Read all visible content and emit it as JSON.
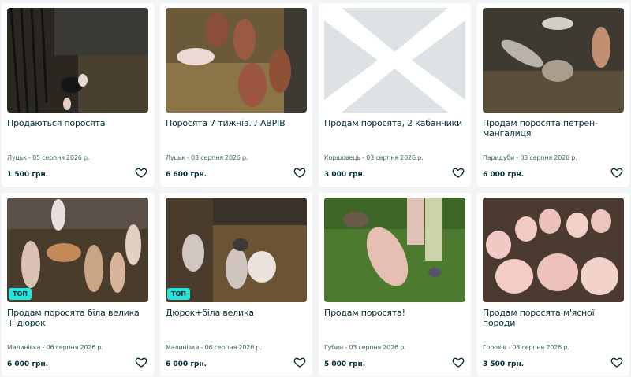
{
  "listings": [
    {
      "title": "Продаються поросята",
      "location_date": "Луцьк - 05 серпня 2026 р.",
      "price": "1 500 грн.",
      "badge": "",
      "photo": "pigs-in-dark-pen"
    },
    {
      "title": "Поросята 7 тижнів. ЛАВРІВ",
      "location_date": "Луцьк - 03 серпня 2026 р.",
      "price": "6 600 грн.",
      "badge": "",
      "photo": "brown-and-white-pigs-on-straw"
    },
    {
      "title": "Продам поросята, 2 кабанчики",
      "location_date": "Коршовець - 03 серпня 2026 р.",
      "price": "3 000 грн.",
      "badge": "",
      "photo": "no-photo-placeholder"
    },
    {
      "title": "Продам поросята петрен-мангалиця",
      "location_date": "Паридуби - 03 серпня 2026 р.",
      "price": "6 000 грн.",
      "badge": "",
      "photo": "striped-piglets"
    },
    {
      "title": "Продам поросята біла велика + дюрок",
      "location_date": "Малинівка - 06 серпня 2026 р.",
      "price": "6 000 грн.",
      "badge": "ТОП",
      "photo": "group-of-piglets-in-pen"
    },
    {
      "title": "Дюрок+біла велика",
      "location_date": "Малинівка - 06 серпня 2026 р.",
      "price": "6 000 грн.",
      "badge": "ТОП",
      "photo": "spotted-pigs-on-straw"
    },
    {
      "title": "Продам поросята!",
      "location_date": "Губин - 03 серпня 2026 р.",
      "price": "5 000 грн.",
      "badge": "",
      "photo": "pig-on-grass"
    },
    {
      "title": "Продам поросята м'ясної породи",
      "location_date": "Горохів - 03 серпня 2026 р.",
      "price": "3 500 грн.",
      "badge": "",
      "photo": "pink-piglets-crowd"
    }
  ],
  "icons": {
    "favorite": "heart-outline-icon"
  },
  "colors": {
    "badge": "#23e5db",
    "text": "#002f34",
    "muted": "#406367",
    "background": "#f2f4f5"
  }
}
